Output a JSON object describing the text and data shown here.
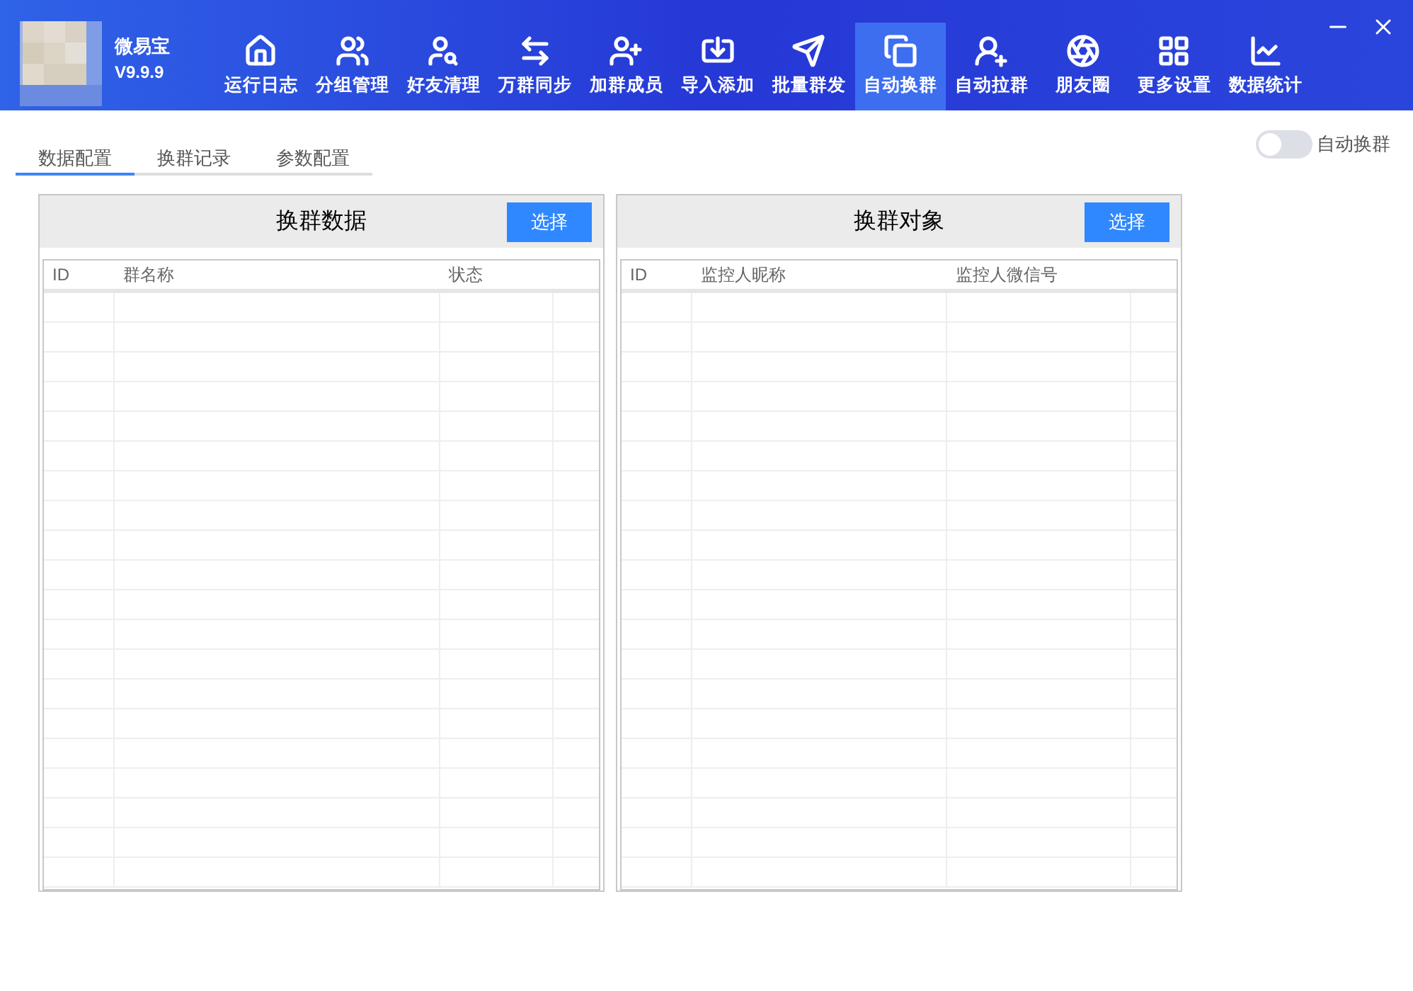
{
  "app": {
    "name": "微易宝",
    "version": "V9.9.9"
  },
  "nav": [
    {
      "label": "运行日志",
      "selected": false
    },
    {
      "label": "分组管理",
      "selected": false
    },
    {
      "label": "好友清理",
      "selected": false
    },
    {
      "label": "万群同步",
      "selected": false
    },
    {
      "label": "加群成员",
      "selected": false
    },
    {
      "label": "导入添加",
      "selected": false
    },
    {
      "label": "批量群发",
      "selected": false
    },
    {
      "label": "自动换群",
      "selected": true
    },
    {
      "label": "自动拉群",
      "selected": false
    },
    {
      "label": "朋友圈",
      "selected": false
    },
    {
      "label": "更多设置",
      "selected": false
    },
    {
      "label": "数据统计",
      "selected": false
    }
  ],
  "tabs": [
    {
      "label": "数据配置",
      "selected": true
    },
    {
      "label": "换群记录",
      "selected": false
    },
    {
      "label": "参数配置",
      "selected": false
    }
  ],
  "toggle": {
    "label": "自动换群",
    "on": false
  },
  "panels": [
    {
      "title": "换群数据",
      "button": "选择",
      "columns": [
        "ID",
        "群名称",
        "状态"
      ]
    },
    {
      "title": "换群对象",
      "button": "选择",
      "columns": [
        "ID",
        "监控人昵称",
        "监控人微信号"
      ]
    }
  ]
}
